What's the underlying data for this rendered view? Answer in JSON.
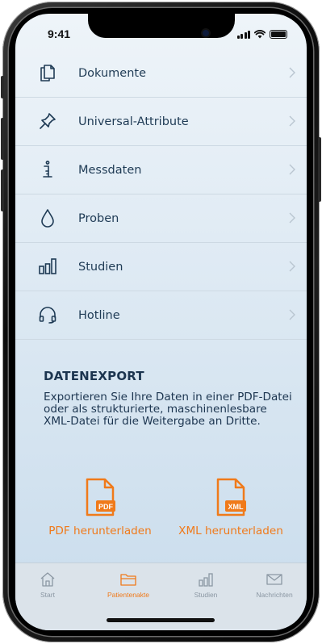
{
  "status_bar": {
    "time": "9:41"
  },
  "menu": {
    "items": [
      {
        "label": "Dokumente",
        "icon": "document-icon"
      },
      {
        "label": "Universal-Attribute",
        "icon": "pin-icon"
      },
      {
        "label": "Messdaten",
        "icon": "measure-icon"
      },
      {
        "label": "Proben",
        "icon": "drop-icon"
      },
      {
        "label": "Studien",
        "icon": "bar-chart-icon"
      },
      {
        "label": "Hotline",
        "icon": "headset-icon"
      }
    ]
  },
  "export": {
    "title": "DATENEXPORT",
    "description": "Exportieren Sie Ihre Daten in einer PDF-Datei oder als strukturierte, maschinenlesbare XML-Datei für die Weitergabe an Dritte.",
    "pdf": {
      "badge": "PDF",
      "label": "PDF herunterladen"
    },
    "xml": {
      "badge": "XML",
      "label": "XML herunterladen"
    }
  },
  "tabbar": {
    "active": "Patientenakte",
    "tabs": [
      {
        "label": "Start",
        "icon": "home-icon"
      },
      {
        "label": "Patientenakte",
        "icon": "folder-icon"
      },
      {
        "label": "Studien",
        "icon": "bar-chart-icon"
      },
      {
        "label": "Nachrichten",
        "icon": "mail-icon"
      }
    ]
  },
  "colors": {
    "accent": "#f07a1a",
    "text": "#1f3b55",
    "inactive": "#8b97a3"
  }
}
